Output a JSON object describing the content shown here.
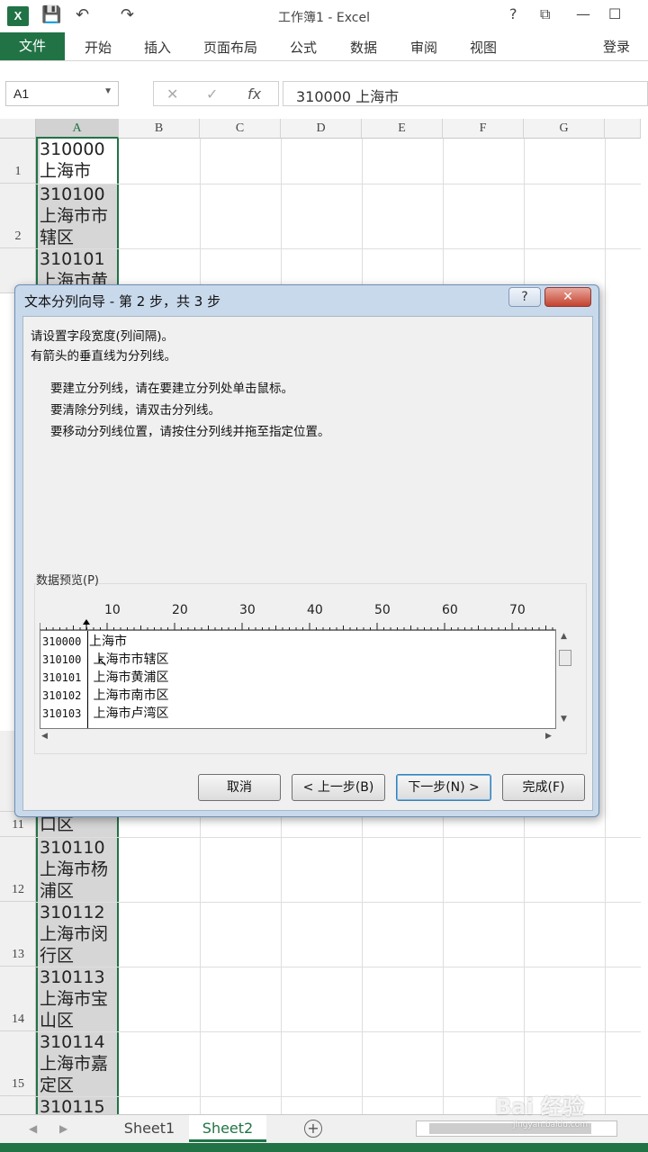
{
  "app": {
    "title": "工作簿1 - Excel",
    "logo": "X",
    "qa_save": "💾",
    "qa_undo": "↶",
    "qa_redo": "↷",
    "help": "?",
    "restore": "⧉",
    "minimize": "—",
    "maximize": "☐"
  },
  "ribbon": {
    "file": "文件",
    "tabs": [
      "开始",
      "插入",
      "页面布局",
      "公式",
      "数据",
      "审阅",
      "视图"
    ],
    "login": "登录"
  },
  "formula_bar": {
    "name_box": "A1",
    "cancel": "✕",
    "enter": "✓",
    "fx": "fx",
    "formula": "310000  上海市"
  },
  "sheet": {
    "columns": [
      "A",
      "B",
      "C",
      "D",
      "E",
      "F",
      "G"
    ],
    "rows_top": [
      {
        "num": "1",
        "text": "310000\n上海市"
      },
      {
        "num": "2",
        "text": "310100\n上海市市\n辖区"
      },
      {
        "num": "",
        "text": "310101\n上海市黄"
      }
    ],
    "rows_bottom": [
      {
        "num": "11",
        "text": "口区"
      },
      {
        "num": "12",
        "text": "310110\n上海市杨\n浦区"
      },
      {
        "num": "13",
        "text": "310112\n上海市闵\n行区"
      },
      {
        "num": "14",
        "text": "310113\n上海市宝\n山区"
      },
      {
        "num": "15",
        "text": "310114\n上海市嘉\n定区"
      },
      {
        "num": "",
        "text": "310115"
      }
    ],
    "partial_row_label": "1"
  },
  "sheet_tabs": {
    "tabs": [
      "Sheet1",
      "Sheet2"
    ],
    "active": "Sheet2",
    "add": "+"
  },
  "dialog": {
    "title": "文本分列向导 - 第 2 步，共 3 步",
    "help": "?",
    "close": "✕",
    "intro1": "请设置字段宽度(列间隔)。",
    "intro2": "有箭头的垂直线为分列线。",
    "tip1": "要建立分列线，请在要建立分列处单击鼠标。",
    "tip2": "要清除分列线，请双击分列线。",
    "tip3": "要移动分列线位置，请按住分列线并拖至指定位置。",
    "preview_label": "数据预览(P)",
    "ruler_numbers": [
      "10",
      "20",
      "30",
      "40",
      "50",
      "60",
      "70"
    ],
    "preview_rows": [
      {
        "code": "310000",
        "name": "上海市"
      },
      {
        "code": "310100",
        "name": " 上海市市辖区"
      },
      {
        "code": "310101",
        "name": " 上海市黄浦区"
      },
      {
        "code": "310102",
        "name": " 上海市南市区"
      },
      {
        "code": "310103",
        "name": " 上海市卢湾区"
      }
    ],
    "buttons": {
      "cancel": "取消",
      "back": "< 上一步(B)",
      "next": "下一步(N) >",
      "finish": "完成(F)"
    }
  },
  "watermark": {
    "brand": "Bai 经验",
    "url": "jingyan.baidu.com"
  },
  "colors": {
    "excel_green": "#217346",
    "dialog_frame": "#c9d9ec",
    "close_red": "#c4432f"
  }
}
